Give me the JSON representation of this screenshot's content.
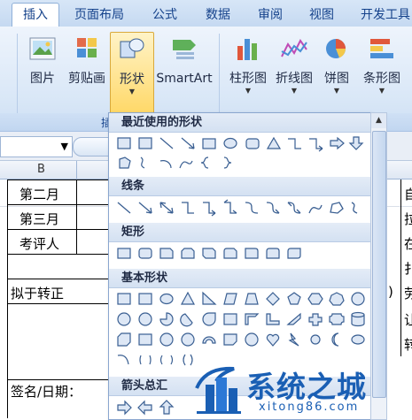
{
  "tabs": [
    {
      "label": "插入",
      "active": true
    },
    {
      "label": "页面布局"
    },
    {
      "label": "公式"
    },
    {
      "label": "数据"
    },
    {
      "label": "审阅"
    },
    {
      "label": "视图"
    },
    {
      "label": "开发工具"
    }
  ],
  "ribbon": {
    "picture": "图片",
    "clipart": "剪贴画",
    "shapes": "形状",
    "smartart": "SmartArt",
    "column": "柱形图",
    "line": "折线图",
    "pie": "饼图",
    "bar": "条形图",
    "group_fragment": "插"
  },
  "namebox": {
    "dropdown": "▼"
  },
  "column_header": {
    "b": "B"
  },
  "sheet": {
    "r1": "第二月",
    "r2": "第三月",
    "r3": "考评人",
    "r4": "拟于转正",
    "r5": "签名/日期：",
    "right_frags": [
      "自",
      "拉",
      "在",
      "扌",
      "劳",
      "让",
      "转"
    ],
    "paren": ")"
  },
  "shapes_menu": {
    "recent": "最近使用的形状",
    "lines": "线条",
    "rect": "矩形",
    "basic": "基本形状",
    "arrows": "箭头总汇"
  },
  "watermark": {
    "name": "系统之城",
    "url": "xitong86.com"
  },
  "colors": {
    "accent": "#15428b",
    "ribbon": "#d9e7f7",
    "shape_fill": "#dde7f5",
    "shape_stroke": "#3a5f92",
    "watermark": "#1a5fb4"
  }
}
